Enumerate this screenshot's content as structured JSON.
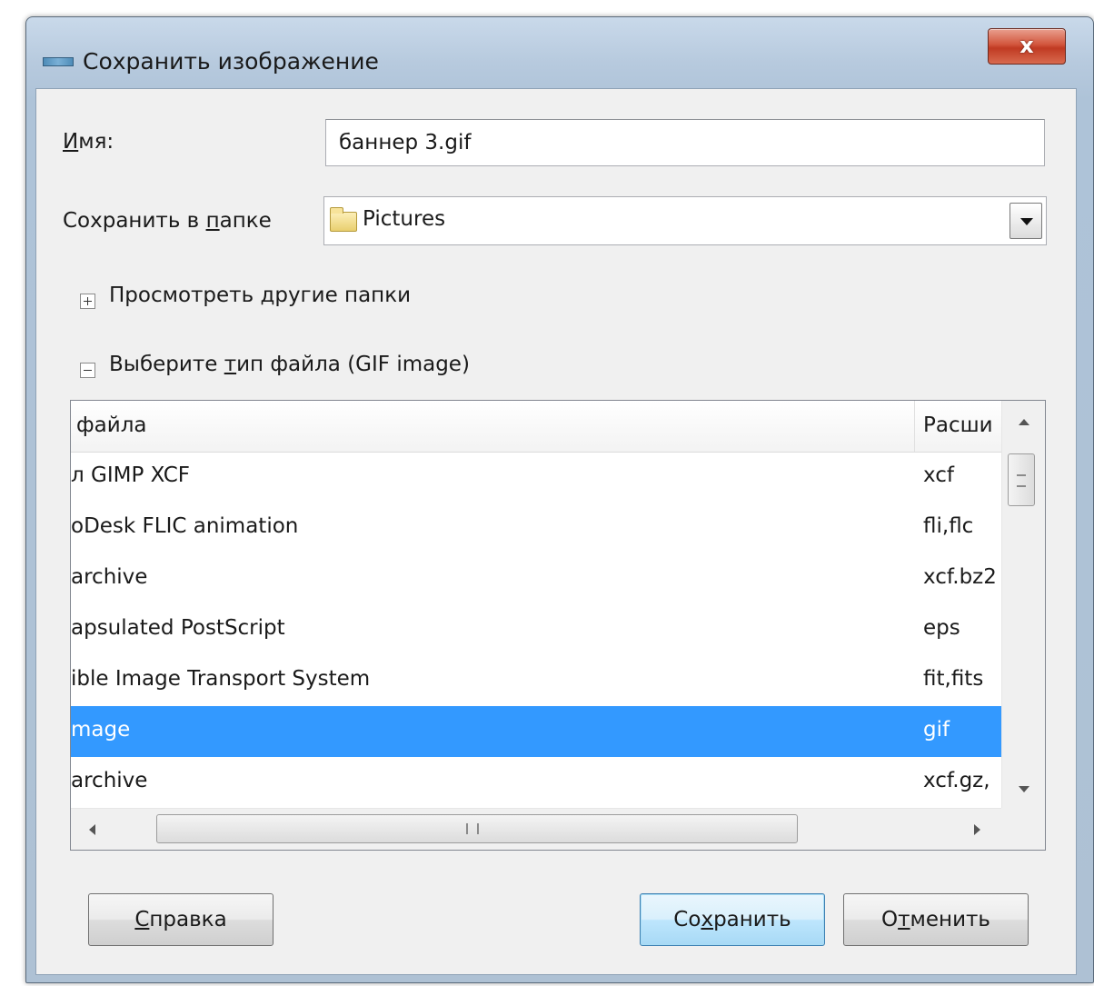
{
  "window": {
    "title": "Сохранить изображение",
    "close_label": "x"
  },
  "form": {
    "name_label_underlined": "И",
    "name_label_rest": "мя:",
    "name_value": "баннер 3.gif",
    "folder_label_prefix": "Сохранить в ",
    "folder_label_underlined": "п",
    "folder_label_rest": "апке",
    "folder_value": "Pictures",
    "browse_other": "Просмотреть другие папки",
    "file_type_prefix": "Выберите ",
    "file_type_underlined": "т",
    "file_type_rest": "ип файла (GIF image)"
  },
  "file_types": {
    "columns": {
      "name": "файла",
      "ext": "Расши"
    },
    "rows": [
      {
        "name": "л GIMP XCF",
        "ext": "xcf",
        "selected": false
      },
      {
        "name": "oDesk FLIC animation",
        "ext": "fli,flc",
        "selected": false
      },
      {
        "name": " archive",
        "ext": "xcf.bz2",
        "selected": false
      },
      {
        "name": "apsulated PostScript",
        "ext": "eps",
        "selected": false
      },
      {
        "name": "ible Image Transport System",
        "ext": "fit,fits",
        "selected": false
      },
      {
        "name": "mage",
        "ext": "gif",
        "selected": true
      },
      {
        "name": " archive",
        "ext": "xcf.gz,",
        "selected": false
      }
    ]
  },
  "buttons": {
    "help_underlined": "С",
    "help_rest": "правка",
    "save_prefix": "Со",
    "save_underlined": "х",
    "save_rest": "ранить",
    "cancel_prefix": "О",
    "cancel_underlined": "т",
    "cancel_rest": "менить"
  },
  "colors": {
    "selection": "#3399ff",
    "window_frame": "#aec3d8",
    "close_button": "#c8462d"
  },
  "icons": [
    "app-icon",
    "close-icon",
    "folder-icon",
    "combo-arrow-icon",
    "plus-icon",
    "minus-icon",
    "scroll-up-icon",
    "scroll-down-icon",
    "scroll-left-icon",
    "scroll-right-icon"
  ]
}
